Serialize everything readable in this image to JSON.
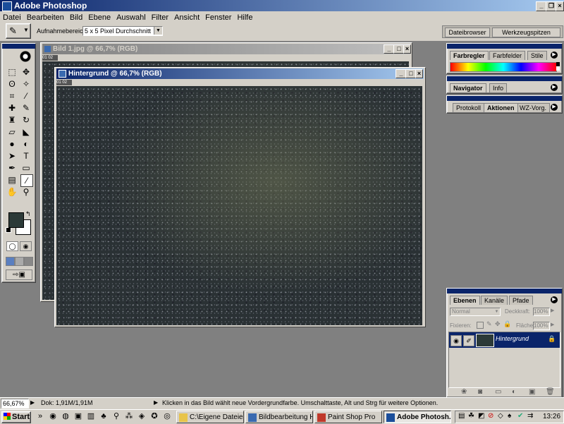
{
  "app": {
    "title": "Adobe Photoshop"
  },
  "menu": [
    "Datei",
    "Bearbeiten",
    "Bild",
    "Ebene",
    "Auswahl",
    "Filter",
    "Ansicht",
    "Fenster",
    "Hilfe"
  ],
  "options": {
    "label": "Aufnahmebereich:",
    "value": "5 x 5 Pixel Durchschnitt"
  },
  "palette_well": {
    "tab1": "Dateibrowser",
    "tab2": "Werkzeugspitzen"
  },
  "doc_back": {
    "title": "Bild 1.jpg @ 66,7% (RGB)"
  },
  "doc_front": {
    "title": "Hintergrund @ 66,7% (RGB)"
  },
  "panels": {
    "color": [
      "Farbregler",
      "Farbfelder",
      "Stile"
    ],
    "nav": [
      "Navigator",
      "Info"
    ],
    "hist": [
      "Protokoll",
      "Aktionen",
      "WZ-Vorg."
    ],
    "layers": {
      "tabs": [
        "Ebenen",
        "Kanäle",
        "Pfade"
      ],
      "blend": "Normal",
      "opacity_label": "Deckkraft:",
      "opacity": "100%",
      "fix_label": "Fixieren:",
      "fill_label": "Fläche:",
      "fill": "100%",
      "layer_name": "Hintergrund"
    }
  },
  "status": {
    "zoom": "66,67%",
    "doc": "Dok: 1,91M/1,91M",
    "hint": "Klicken in das Bild wählt neue Vordergrundfarbe. Umschalttaste, Alt und Strg für weitere Optionen."
  },
  "taskbar": {
    "start": "Start",
    "items": [
      "C:\\Eigene Dateien...",
      "Bildbearbeitung Hi...",
      "Paint Shop Pro",
      "Adobe Photosh..."
    ],
    "clock": "13:26"
  },
  "colors": {
    "titlebar": "#0a246a",
    "face": "#d4d0c8",
    "desktop": "#808080",
    "foreground": "#2c3a38"
  }
}
